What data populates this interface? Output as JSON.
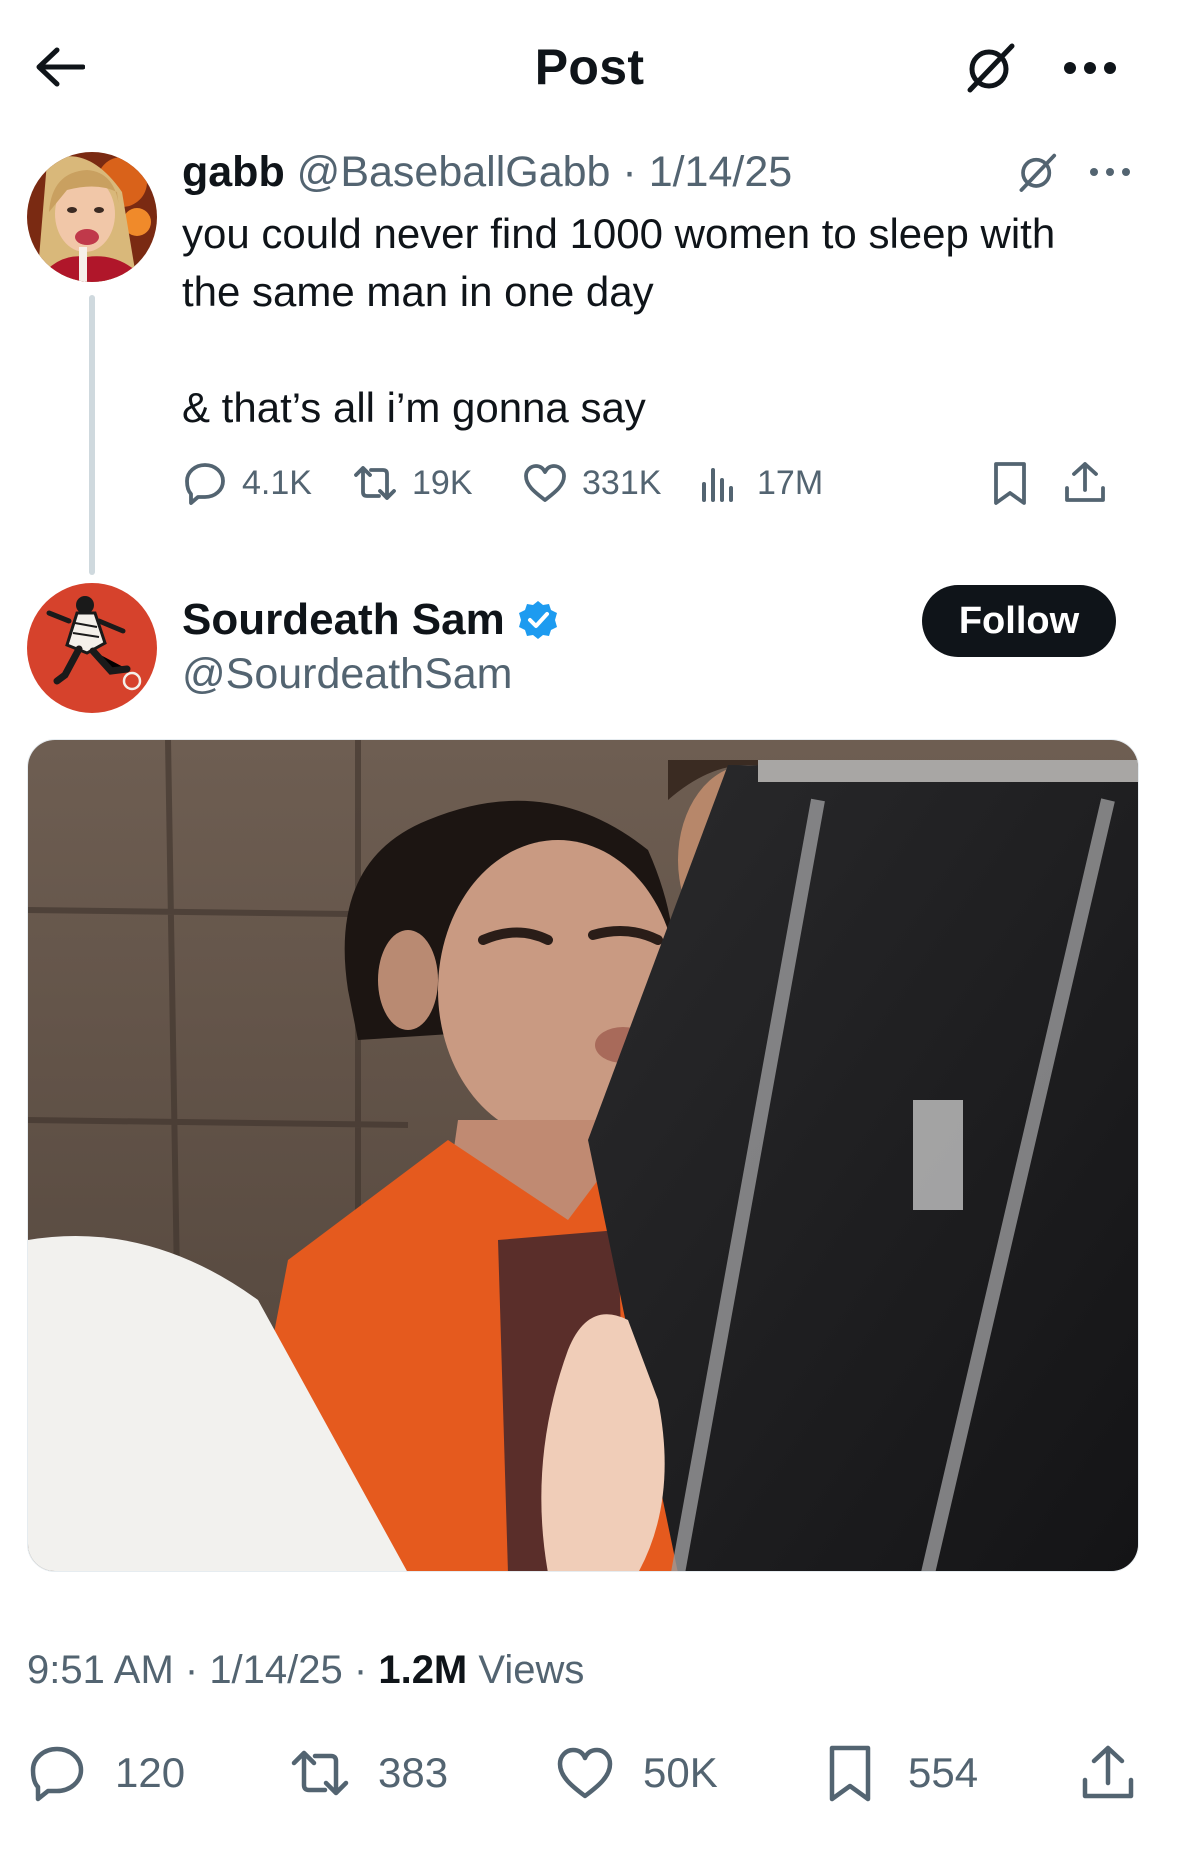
{
  "header": {
    "title": "Post",
    "back_icon": "arrow-left-icon",
    "grok_icon": "grok-icon",
    "more_icon": "more-horizontal-icon"
  },
  "quoted_post": {
    "author_name": "gabb",
    "author_handle": "@BaseballGabb",
    "separator": " · ",
    "date": "1/14/25",
    "text_lines": [
      "you could never find 1000 women to sleep with",
      "the same man in one day",
      "& that’s all i’m gonna say"
    ],
    "actions": {
      "replies": "4.1K",
      "reposts": "19K",
      "likes": "331K",
      "views": "17M"
    }
  },
  "main_post": {
    "author_name": "Sourdeath Sam",
    "verified": true,
    "author_handle": "@SourdeathSam",
    "follow_label": "Follow",
    "time": "9:51 AM",
    "date": "1/14/25",
    "separator": " · ",
    "views_count": "1.2M",
    "views_label": "Views",
    "actions": {
      "replies": "120",
      "reposts": "383",
      "likes": "50K",
      "bookmarks": "554"
    }
  },
  "colors": {
    "text": "#0f1419",
    "muted": "#536471",
    "verified_blue": "#1d9bf0",
    "follow_bg": "#0f1419"
  }
}
